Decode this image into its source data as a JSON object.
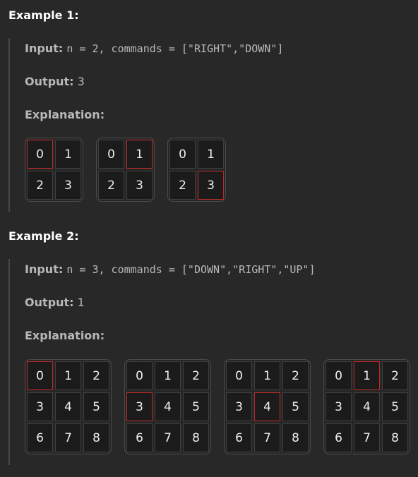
{
  "example1": {
    "title": "Example 1:",
    "input_label": "Input:",
    "input_value": "n = 2, commands = [\"RIGHT\",\"DOWN\"]",
    "output_label": "Output:",
    "output_value": "3",
    "explanation_label": "Explanation:",
    "grids": [
      {
        "cells": [
          "0",
          "1",
          "2",
          "3"
        ],
        "active": 0
      },
      {
        "cells": [
          "0",
          "1",
          "2",
          "3"
        ],
        "active": 1
      },
      {
        "cells": [
          "0",
          "1",
          "2",
          "3"
        ],
        "active": 3
      }
    ]
  },
  "example2": {
    "title": "Example 2:",
    "input_label": "Input:",
    "input_value": "n = 3, commands = [\"DOWN\",\"RIGHT\",\"UP\"]",
    "output_label": "Output:",
    "output_value": "1",
    "explanation_label": "Explanation:",
    "grids": [
      {
        "cells": [
          "0",
          "1",
          "2",
          "3",
          "4",
          "5",
          "6",
          "7",
          "8"
        ],
        "active": 0
      },
      {
        "cells": [
          "0",
          "1",
          "2",
          "3",
          "4",
          "5",
          "6",
          "7",
          "8"
        ],
        "active": 3
      },
      {
        "cells": [
          "0",
          "1",
          "2",
          "3",
          "4",
          "5",
          "6",
          "7",
          "8"
        ],
        "active": 4
      },
      {
        "cells": [
          "0",
          "1",
          "2",
          "3",
          "4",
          "5",
          "6",
          "7",
          "8"
        ],
        "active": 1
      }
    ]
  },
  "colors": {
    "active_border": "#c02a2a",
    "background": "#282828"
  }
}
